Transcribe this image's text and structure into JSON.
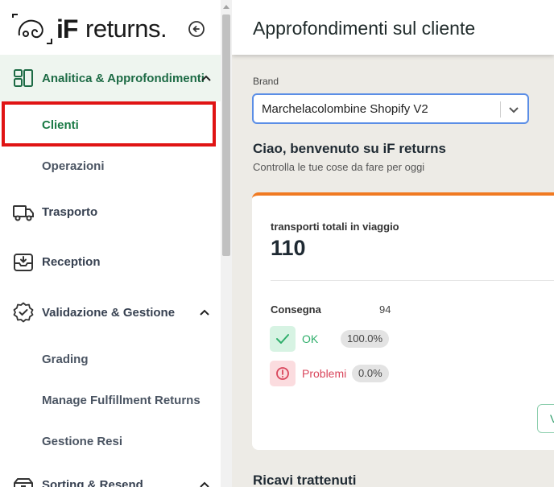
{
  "app": {
    "logo_if": "iF",
    "logo_returns": "returns."
  },
  "sidebar": {
    "items": [
      {
        "label": "Analitica & Approfondimenti",
        "icon": "dashboard-icon",
        "expanded": true
      },
      {
        "label": "Clienti",
        "sub": true,
        "active": true
      },
      {
        "label": "Operazioni",
        "sub": true
      },
      {
        "label": "Trasporto",
        "icon": "truck-icon"
      },
      {
        "label": "Reception",
        "icon": "inbox-download-icon"
      },
      {
        "label": "Validazione & Gestione",
        "icon": "check-badge-icon",
        "expanded": true
      },
      {
        "label": "Grading",
        "sub": true
      },
      {
        "label": "Manage Fulfillment Returns",
        "sub": true
      },
      {
        "label": "Gestione Resi",
        "sub": true
      },
      {
        "label": "Sorting & Resend",
        "icon": "package-icon",
        "expanded": true
      }
    ]
  },
  "header": {
    "title": "Approfondimenti sul cliente"
  },
  "brand": {
    "label": "Brand",
    "value": "Marchelacolombine Shopify V2"
  },
  "welcome": {
    "title": "Ciao, benvenuto su iF returns",
    "subtitle": "Controlla le tue cose da fare per oggi"
  },
  "card": {
    "title": "transporti totali in viaggio",
    "count": "110",
    "consegna_label": "Consegna",
    "consegna_value": "94",
    "ok_label": "OK",
    "ok_value": "100.0%",
    "problems_label": "Problemi",
    "problems_value": "0.0%",
    "button_letter": "V"
  },
  "section": {
    "title": "Ricavi trattenuti"
  },
  "colors": {
    "accent_green": "#1d6b45",
    "card_border": "#f07a22",
    "highlight": "#e01414",
    "select_border": "#5b8ee6"
  }
}
